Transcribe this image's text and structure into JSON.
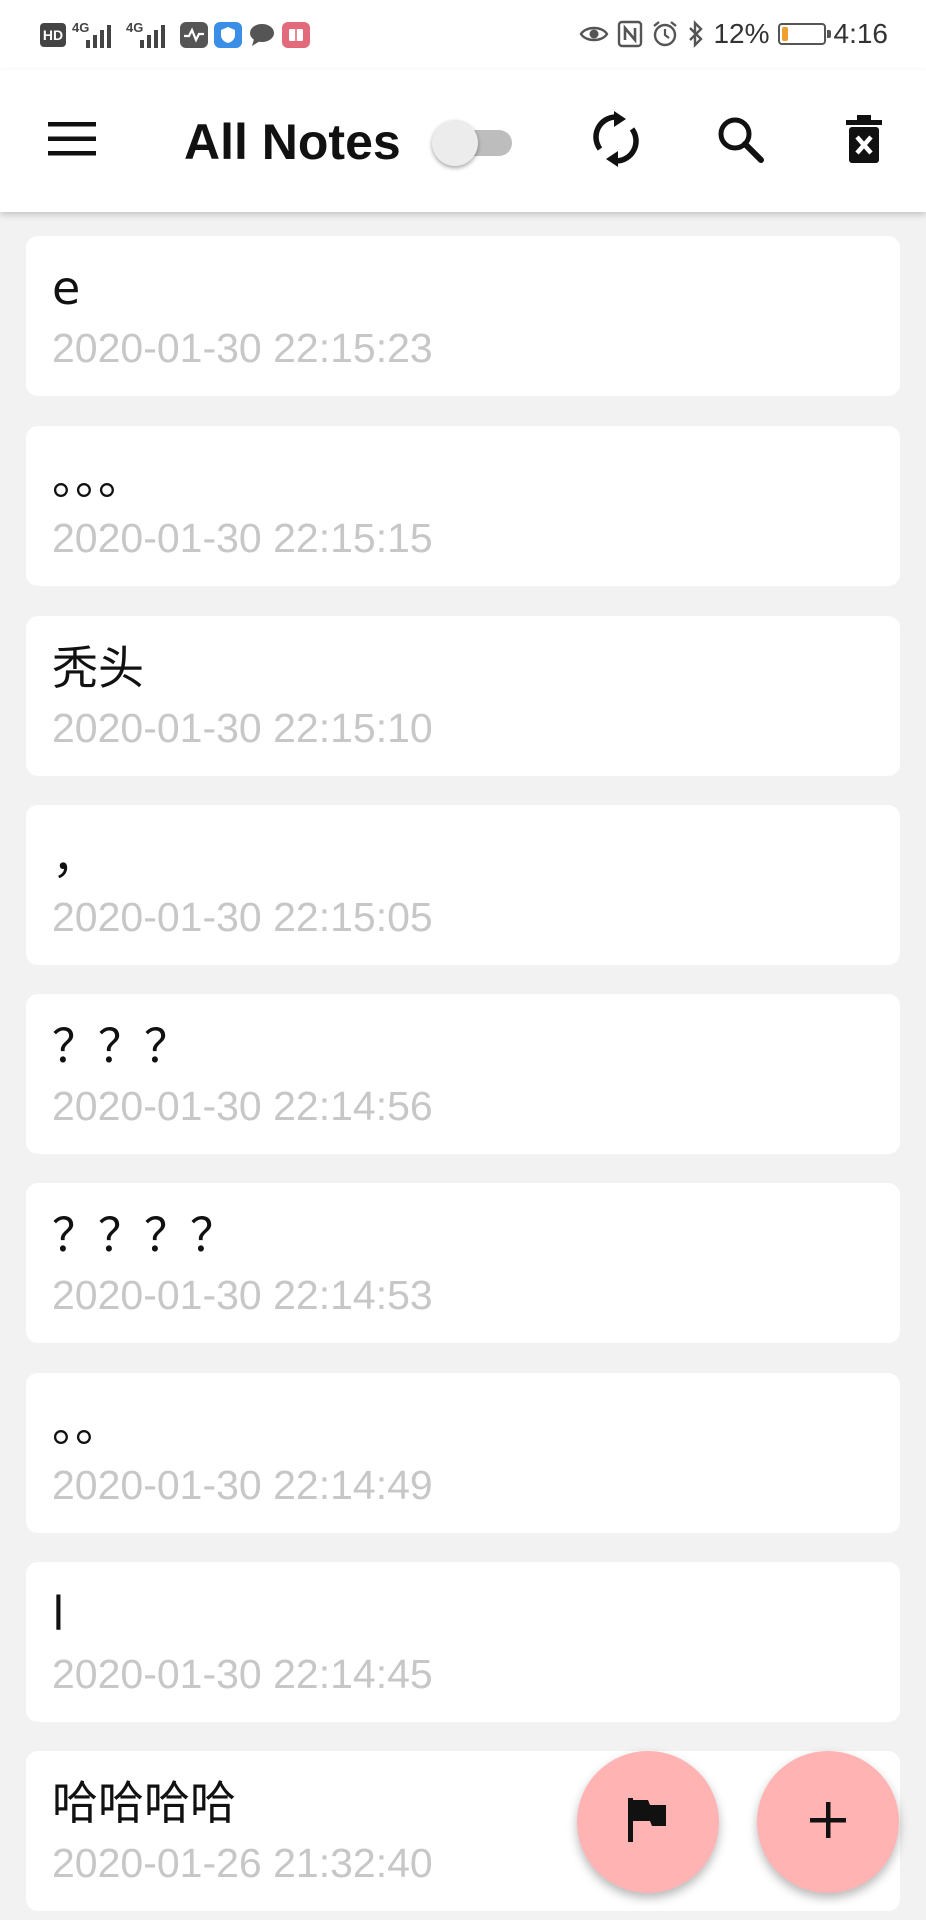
{
  "status_bar": {
    "hd_label": "HD",
    "sim1_label": "4G",
    "sim2_label": "4G",
    "battery_percent": "12%",
    "battery_level": 0.12,
    "time": "4:16"
  },
  "app_bar": {
    "title": "All Notes",
    "toggle_on": false
  },
  "notes": [
    {
      "title": "e",
      "time": "2020-01-30 22:15:23"
    },
    {
      "title": "。。。",
      "time": "2020-01-30 22:15:15"
    },
    {
      "title": "秃头",
      "time": "2020-01-30 22:15:10"
    },
    {
      "title": "，",
      "time": "2020-01-30 22:15:05"
    },
    {
      "title": "？？？",
      "time": "2020-01-30 22:14:56"
    },
    {
      "title": "？？？？",
      "time": "2020-01-30 22:14:53"
    },
    {
      "title": "。。",
      "time": "2020-01-30 22:14:49"
    },
    {
      "title": "l",
      "time": "2020-01-30 22:14:45"
    },
    {
      "title": "哈哈哈哈",
      "time": "2020-01-26 21:32:40"
    }
  ],
  "icons": {
    "menu": "menu-icon",
    "sync": "sync-icon",
    "search": "search-icon",
    "delete": "delete-icon",
    "flag": "flag-icon",
    "add": "add-icon"
  },
  "colors": {
    "fab": "#ffb3b3",
    "timestamp": "#c7c7c7",
    "background": "#f2f2f2"
  }
}
